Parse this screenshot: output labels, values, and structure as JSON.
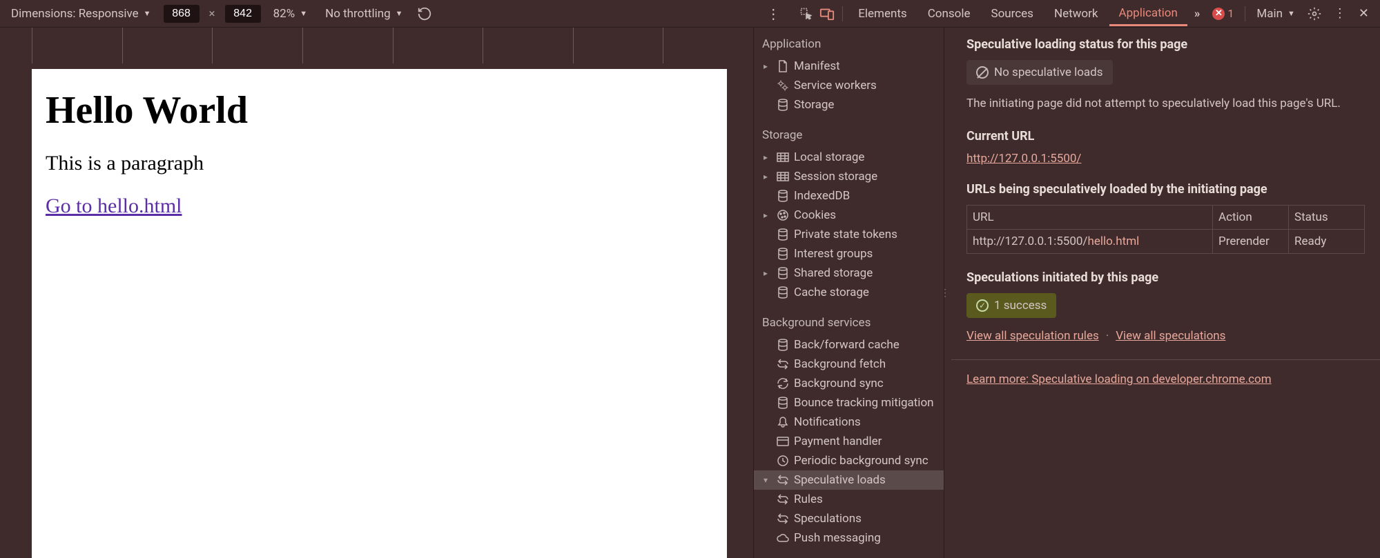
{
  "toolbar": {
    "dimensions_label": "Dimensions: Responsive",
    "width": "868",
    "height": "842",
    "zoom": "82%",
    "throttling": "No throttling"
  },
  "devtools_tabs": {
    "elements": "Elements",
    "console": "Console",
    "sources": "Sources",
    "network": "Network",
    "application": "Application"
  },
  "errors": {
    "count": "1"
  },
  "frame_selector": "Main",
  "rendered": {
    "heading": "Hello World",
    "paragraph": "This is a paragraph",
    "link": "Go to hello.html"
  },
  "sidebar": {
    "application": {
      "heading": "Application",
      "manifest": "Manifest",
      "service_workers": "Service workers",
      "storage": "Storage"
    },
    "storage": {
      "heading": "Storage",
      "local_storage": "Local storage",
      "session_storage": "Session storage",
      "indexeddb": "IndexedDB",
      "cookies": "Cookies",
      "private_state": "Private state tokens",
      "interest_groups": "Interest groups",
      "shared_storage": "Shared storage",
      "cache_storage": "Cache storage"
    },
    "background": {
      "heading": "Background services",
      "back_forward": "Back/forward cache",
      "bg_fetch": "Background fetch",
      "bg_sync": "Background sync",
      "bounce": "Bounce tracking mitigation",
      "notifications": "Notifications",
      "payment": "Payment handler",
      "periodic": "Periodic background sync",
      "speculative": "Speculative loads",
      "rules": "Rules",
      "speculations": "Speculations",
      "push": "Push messaging"
    }
  },
  "details": {
    "status_heading": "Speculative loading status for this page",
    "no_loads": "No speculative loads",
    "no_loads_desc": "The initiating page did not attempt to speculatively load this page's URL.",
    "current_url_heading": "Current URL",
    "current_url": "http://127.0.0.1:5500/",
    "urls_heading": "URLs being speculatively loaded by the initiating page",
    "table": {
      "col_url": "URL",
      "col_action": "Action",
      "col_status": "Status",
      "row_url_prefix": "http://127.0.0.1:5500/",
      "row_url_suffix": "hello.html",
      "row_action": "Prerender",
      "row_status": "Ready"
    },
    "initiated_heading": "Speculations initiated by this page",
    "success_count": "1 success",
    "view_rules": "View all speculation rules",
    "view_specs": "View all speculations",
    "learn_more": "Learn more: Speculative loading on developer.chrome.com"
  }
}
